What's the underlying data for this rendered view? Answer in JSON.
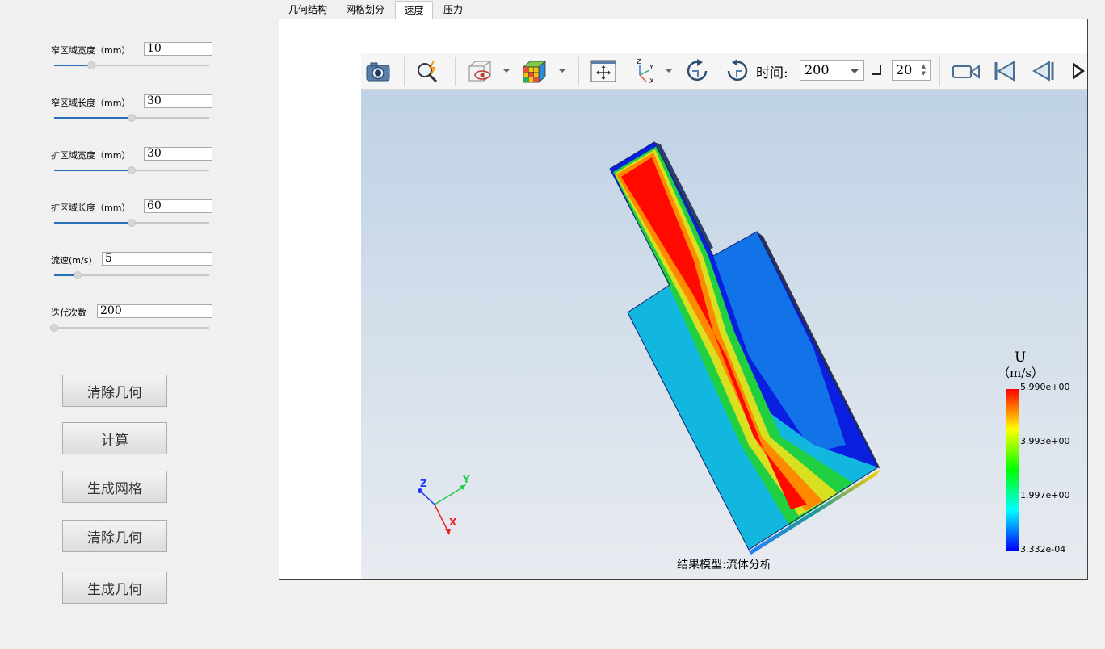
{
  "params": [
    {
      "label": "窄区域宽度（mm）",
      "value": "10",
      "level": 0.24
    },
    {
      "label": "窄区域长度（mm）",
      "value": "30",
      "level": 0.5
    },
    {
      "label": "扩区域宽度（mm）",
      "value": "30",
      "level": 0.5
    },
    {
      "label": "扩区域长度（mm）",
      "value": "60",
      "level": 0.5
    },
    {
      "label": "流速(m/s)",
      "value": "5",
      "level": 0.15
    },
    {
      "label": "迭代次数",
      "value": "200",
      "level": 0.0
    }
  ],
  "buttons": [
    "清除几何",
    "计算",
    "生成网格",
    "清除几何",
    "生成几何"
  ],
  "tabs": [
    "几何结构",
    "网格划分",
    "速度",
    "压力"
  ],
  "active_tab": "速度",
  "toolbar": {
    "time_label": "时间:",
    "time_value": "200",
    "step_value": "20",
    "icons": [
      "camera-icon",
      "zoom-icon",
      "visibility-icon",
      "colormap-icon",
      "fit-view-icon",
      "axes-icon",
      "rotate-cw-icon",
      "rotate-ccw-icon",
      "record-icon",
      "first-frame-icon",
      "prev-frame-icon",
      "next-frame-icon"
    ]
  },
  "viewport": {
    "caption": "结果模型:流体分析",
    "axes_labels": {
      "x": "X",
      "y": "Y",
      "z": "Z"
    }
  },
  "legend": {
    "title": "U",
    "unit": "（m/s）",
    "ticks": [
      "5.990e+00",
      "3.993e+00",
      "1.997e+00",
      "3.332e-04"
    ],
    "colors": [
      "#ff0000",
      "#ffff00",
      "#00ff00",
      "#00ffff",
      "#0000ff"
    ]
  }
}
